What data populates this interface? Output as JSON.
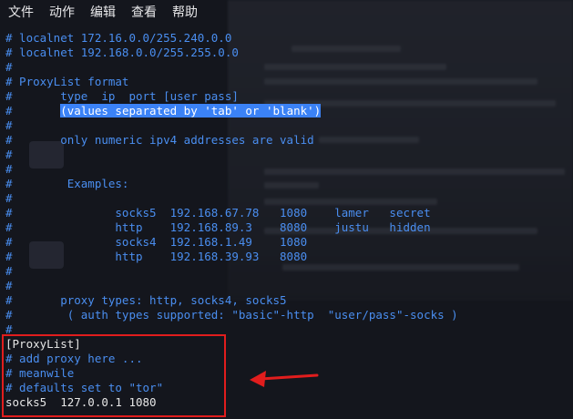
{
  "menubar": {
    "items": [
      "文件",
      "动作",
      "编辑",
      "查看",
      "帮助"
    ]
  },
  "terminal": {
    "lines": [
      {
        "text": "# localnet 172.16.0.0/255.240.0.0",
        "color": "blue"
      },
      {
        "text": "# localnet 192.168.0.0/255.255.0.0",
        "color": "blue"
      },
      {
        "text": "#",
        "color": "blue"
      },
      {
        "text": "# ProxyList format",
        "color": "blue"
      },
      {
        "text": "#       type  ip  port [user pass]",
        "color": "blue"
      },
      {
        "text": "#       ",
        "color": "blue",
        "selected": "(values separated by 'tab' or 'blank')"
      },
      {
        "text": "#",
        "color": "blue"
      },
      {
        "text": "#       only numeric ipv4 addresses are valid",
        "color": "blue"
      },
      {
        "text": "#",
        "color": "blue"
      },
      {
        "text": "#",
        "color": "blue"
      },
      {
        "text": "#        Examples:",
        "color": "blue"
      },
      {
        "text": "#",
        "color": "blue"
      },
      {
        "text": "#               socks5  192.168.67.78   1080    lamer   secret",
        "color": "blue"
      },
      {
        "text": "#               http    192.168.89.3    8080    justu   hidden",
        "color": "blue"
      },
      {
        "text": "#               socks4  192.168.1.49    1080",
        "color": "blue"
      },
      {
        "text": "#               http    192.168.39.93   8080",
        "color": "blue"
      },
      {
        "text": "#",
        "color": "blue"
      },
      {
        "text": "#",
        "color": "blue"
      },
      {
        "text": "#       proxy types: http, socks4, socks5",
        "color": "blue"
      },
      {
        "text": "#        ( auth types supported: \"basic\"-http  \"user/pass\"-socks )",
        "color": "blue"
      },
      {
        "text": "#",
        "color": "blue"
      },
      {
        "text": "[ProxyList]",
        "color": "white"
      },
      {
        "text": "# add proxy here ...",
        "color": "blue"
      },
      {
        "text": "# meanwile",
        "color": "blue"
      },
      {
        "text": "# defaults set to \"tor\"",
        "color": "blue"
      },
      {
        "text": "socks5  127.0.0.1 1080",
        "color": "white"
      }
    ]
  },
  "colors": {
    "comment": "#4a8ef0",
    "text": "#e6e6e6",
    "selection": "#3b82f6",
    "annotation": "#e11d1d",
    "background": "#14161d"
  }
}
